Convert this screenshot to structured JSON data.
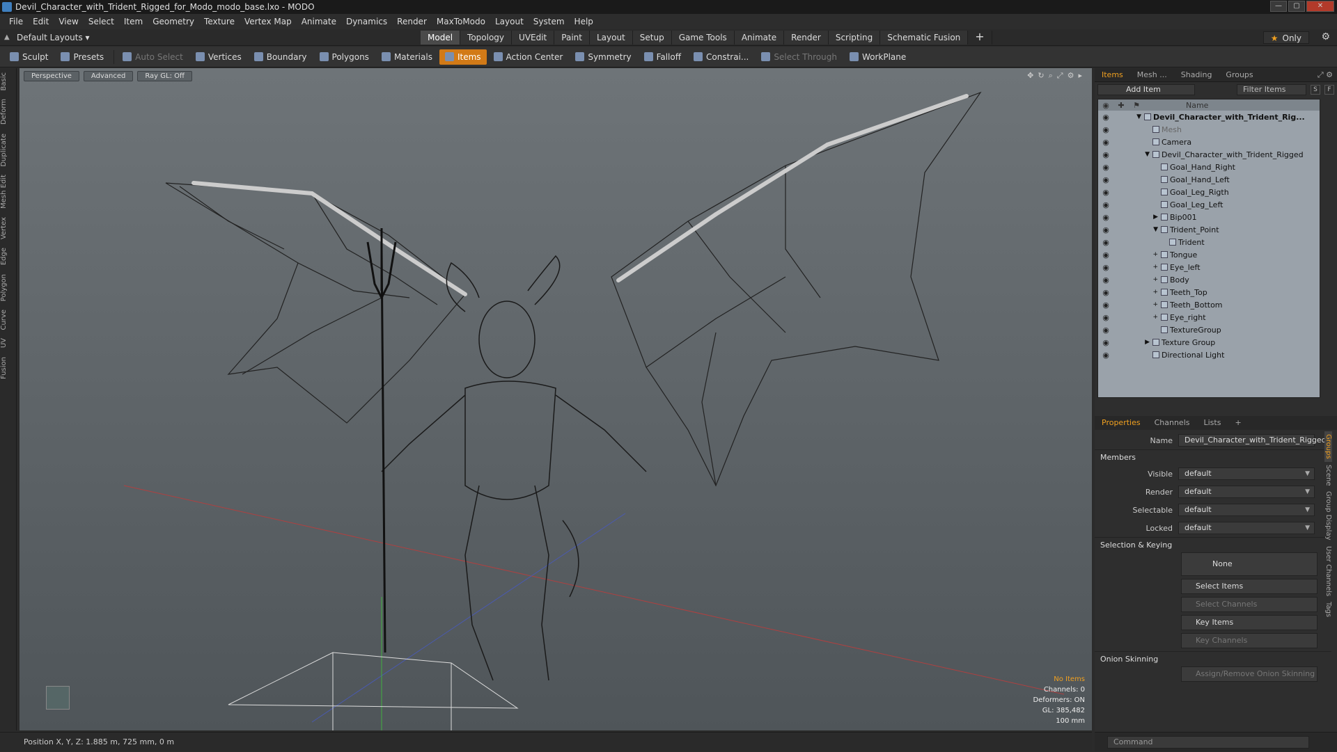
{
  "window": {
    "title": "Devil_Character_with_Trident_Rigged_for_Modo_modo_base.lxo - MODO",
    "min": "—",
    "max": "▢",
    "close": "✕"
  },
  "menu": [
    "File",
    "Edit",
    "View",
    "Select",
    "Item",
    "Geometry",
    "Texture",
    "Vertex Map",
    "Animate",
    "Dynamics",
    "Render",
    "MaxToModo",
    "Layout",
    "System",
    "Help"
  ],
  "layouts": {
    "label": "Default Layouts ▾"
  },
  "layout_tabs": [
    "Model",
    "Topology",
    "UVEdit",
    "Paint",
    "Layout",
    "Setup",
    "Game Tools",
    "Animate",
    "Render",
    "Scripting",
    "Schematic Fusion"
  ],
  "active_layout_tab": "Model",
  "only_label": "Only",
  "toolbar": {
    "sculpt": "Sculpt",
    "presets": "Presets",
    "auto_select": "Auto Select",
    "vertices": "Vertices",
    "boundary": "Boundary",
    "polygons": "Polygons",
    "materials": "Materials",
    "items": "Items",
    "action_center": "Action Center",
    "symmetry": "Symmetry",
    "falloff": "Falloff",
    "constraints": "Constrai...",
    "select_through": "Select Through",
    "workplane": "WorkPlane"
  },
  "left_tabs": [
    "Basic",
    "Deform",
    "Duplicate",
    "Mesh Edit",
    "Vertex",
    "Edge",
    "Polygon",
    "Curve",
    "UV",
    "Fusion"
  ],
  "viewport": {
    "perspective": "Perspective",
    "advanced": "Advanced",
    "raygl": "Ray GL: Off",
    "stats": {
      "no_items": "No Items",
      "channels": "Channels: 0",
      "deformers": "Deformers: ON",
      "gl": "GL: 385,482",
      "scale": "100 mm"
    }
  },
  "status": {
    "position": "Position X, Y, Z:  1.885 m, 725 mm, 0 m"
  },
  "items_panel": {
    "tabs": [
      "Items",
      "Mesh ...",
      "Shading",
      "Groups"
    ],
    "add_item": "Add Item",
    "filter": "Filter Items",
    "col_name": "Name",
    "rows": [
      {
        "label": "Devil_Character_with_Trident_Rig...",
        "indent": 0,
        "expander": "▼",
        "style": "root"
      },
      {
        "label": "Mesh",
        "indent": 1,
        "expander": "",
        "style": "dim"
      },
      {
        "label": "Camera",
        "indent": 1,
        "expander": "",
        "style": ""
      },
      {
        "label": "Devil_Character_with_Trident_Rigged",
        "indent": 1,
        "expander": "▼",
        "style": ""
      },
      {
        "label": "Goal_Hand_Right",
        "indent": 2,
        "expander": "",
        "style": ""
      },
      {
        "label": "Goal_Hand_Left",
        "indent": 2,
        "expander": "",
        "style": ""
      },
      {
        "label": "Goal_Leg_Rigth",
        "indent": 2,
        "expander": "",
        "style": ""
      },
      {
        "label": "Goal_Leg_Left",
        "indent": 2,
        "expander": "",
        "style": ""
      },
      {
        "label": "Bip001",
        "indent": 2,
        "expander": "▶",
        "style": ""
      },
      {
        "label": "Trident_Point",
        "indent": 2,
        "expander": "▼",
        "style": ""
      },
      {
        "label": "Trident",
        "indent": 3,
        "expander": "",
        "style": ""
      },
      {
        "label": "Tongue",
        "indent": 2,
        "expander": "+",
        "style": ""
      },
      {
        "label": "Eye_left",
        "indent": 2,
        "expander": "+",
        "style": ""
      },
      {
        "label": "Body",
        "indent": 2,
        "expander": "+",
        "style": ""
      },
      {
        "label": "Teeth_Top",
        "indent": 2,
        "expander": "+",
        "style": ""
      },
      {
        "label": "Teeth_Bottom",
        "indent": 2,
        "expander": "+",
        "style": ""
      },
      {
        "label": "Eye_right",
        "indent": 2,
        "expander": "+",
        "style": ""
      },
      {
        "label": "TextureGroup",
        "indent": 2,
        "expander": "",
        "style": ""
      },
      {
        "label": "Texture Group",
        "indent": 1,
        "expander": "▶",
        "style": ""
      },
      {
        "label": "Directional Light",
        "indent": 1,
        "expander": "",
        "style": ""
      }
    ]
  },
  "properties": {
    "tabs": [
      "Properties",
      "Channels",
      "Lists"
    ],
    "name_label": "Name",
    "name_value": "Devil_Character_with_Trident_Rigged",
    "members": "Members",
    "visible_label": "Visible",
    "visible_value": "default",
    "render_label": "Render",
    "render_value": "default",
    "selectable_label": "Selectable",
    "selectable_value": "default",
    "locked_label": "Locked",
    "locked_value": "default",
    "sel_keying": "Selection & Keying",
    "none": "None",
    "select_items": "Select Items",
    "select_channels": "Select Channels",
    "key_items": "Key Items",
    "key_channels": "Key Channels",
    "onion": "Onion Skinning",
    "assign_onion": "Assign/Remove Onion Skinning",
    "side_tabs": [
      "Groups",
      "Scene",
      "Group Display",
      "User Channels",
      "Tags"
    ]
  },
  "command": {
    "placeholder": "Command"
  },
  "colors": {
    "accent": "#f0a020",
    "active_tool": "#d27a17",
    "viewport_top": "#6e7478",
    "viewport_bottom": "#4f5559"
  }
}
